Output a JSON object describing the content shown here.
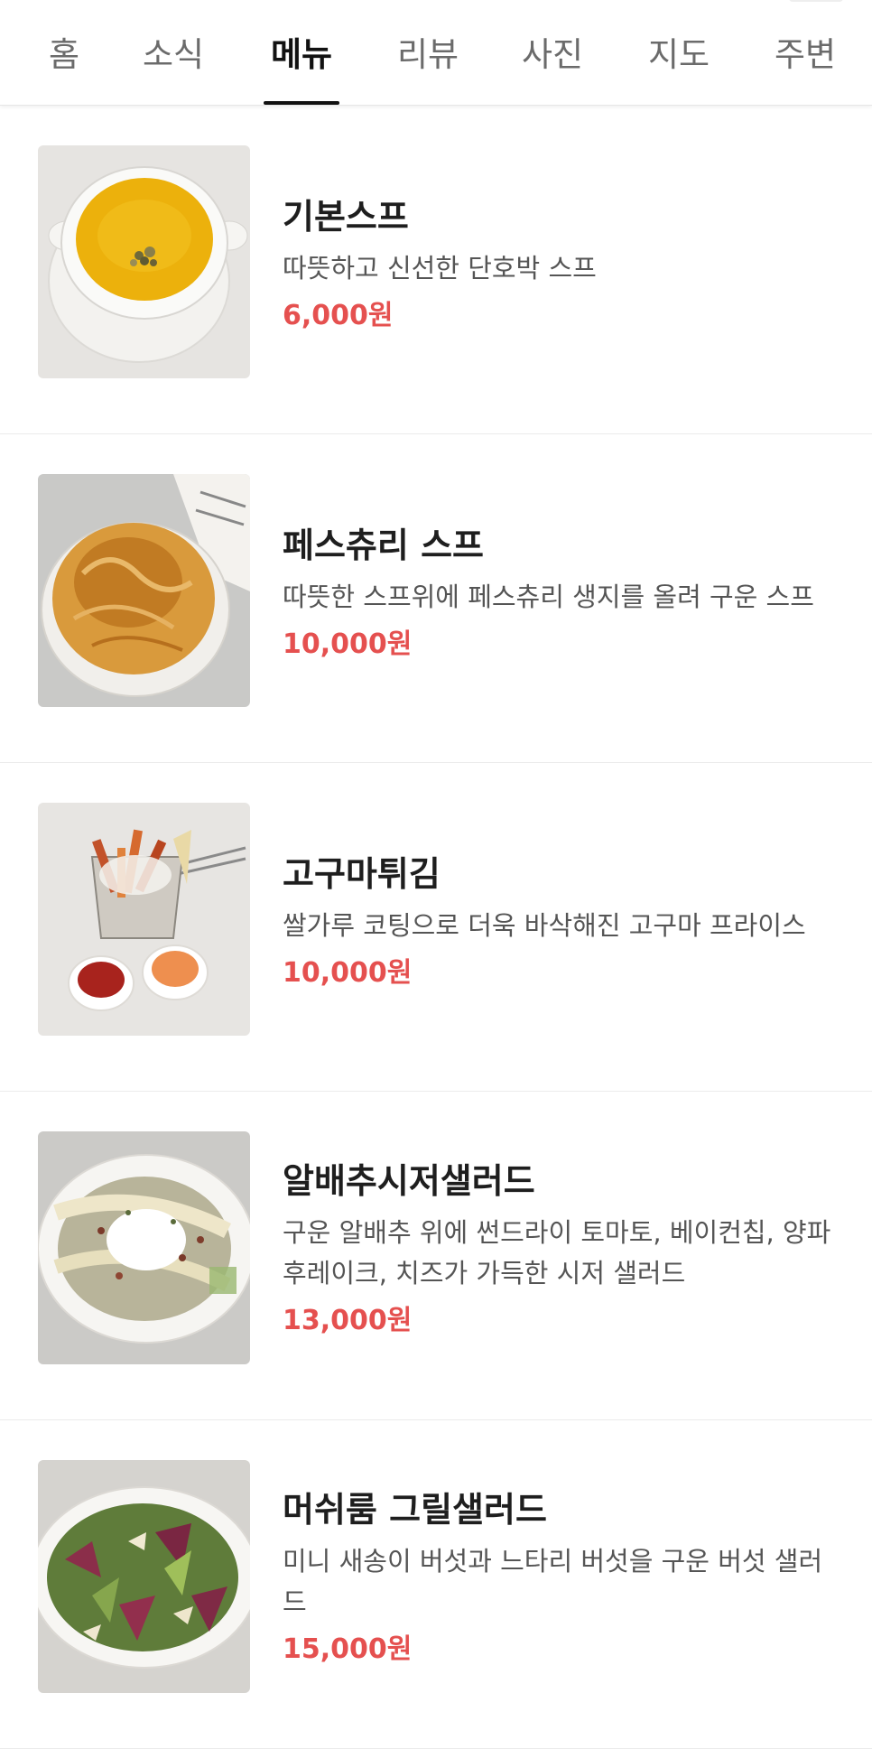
{
  "tabs": [
    {
      "label": "홈",
      "active": false
    },
    {
      "label": "소식",
      "active": false
    },
    {
      "label": "메뉴",
      "active": true
    },
    {
      "label": "리뷰",
      "active": false
    },
    {
      "label": "사진",
      "active": false
    },
    {
      "label": "지도",
      "active": false
    },
    {
      "label": "주변",
      "active": false
    }
  ],
  "menu": [
    {
      "name": "기본스프",
      "description": "따뜻하고 신선한 단호박 스프",
      "price": "6,000원",
      "photo": "pumpkin-soup-photo"
    },
    {
      "name": "페스츄리 스프",
      "description": "따뜻한 스프위에 페스츄리 생지를 올려 구운 스프",
      "price": "10,000원",
      "photo": "pastry-soup-photo"
    },
    {
      "name": "고구마튀김",
      "description": "쌀가루 코팅으로 더욱 바삭해진 고구마 프라이스",
      "price": "10,000원",
      "photo": "sweet-potato-fries-photo"
    },
    {
      "name": "알배추시저샐러드",
      "description": "구운 알배추 위에 썬드라이 토마토, 베이컨칩, 양파 후레이크, 치즈가 가득한 시저 샐러드",
      "price": "13,000원",
      "photo": "caesar-salad-photo"
    },
    {
      "name": "머쉬룸 그릴샐러드",
      "description": "미니 새송이 버섯과 느타리 버섯을 구운 버섯 샐러드",
      "price": "15,000원",
      "photo": "mushroom-salad-photo"
    }
  ],
  "colors": {
    "price": "#e5504f",
    "active_tab": "#111111",
    "inactive_tab": "#6b6b6b"
  }
}
